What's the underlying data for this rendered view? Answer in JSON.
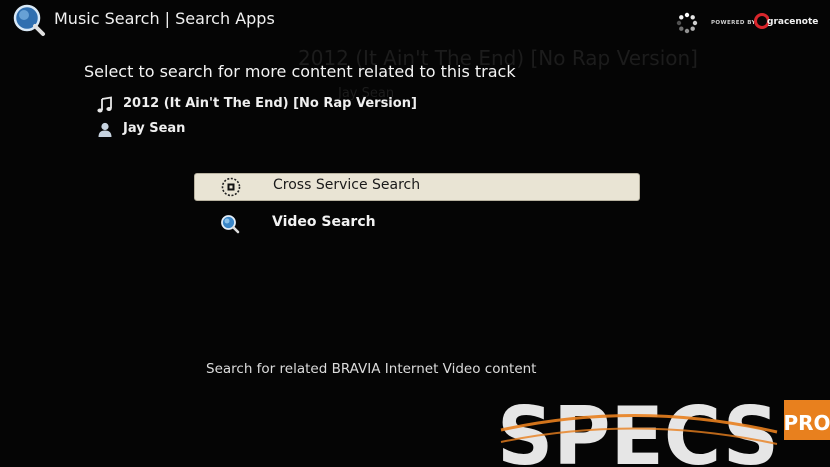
{
  "header": {
    "title": "Music Search | Search Apps",
    "powered_by": "POWERED BY",
    "gracenote": "gracenote"
  },
  "content": {
    "heading": "Select to search for more content related to this track",
    "track": "2012 (It Ain't The End) [No Rap Version]",
    "artist": "Jay Sean"
  },
  "menu": [
    {
      "label": "Cross Service Search",
      "icon": "cross-service-icon",
      "selected": true
    },
    {
      "label": "Video Search",
      "icon": "search-icon",
      "selected": false
    }
  ],
  "description": "Search for related BRAVIA Internet Video content",
  "watermark": {
    "main": "SPECS",
    "badge": "PRO"
  },
  "colors": {
    "background": "#050505",
    "highlight": "#e9e4d4",
    "watermark_orange": "#e8801e"
  }
}
